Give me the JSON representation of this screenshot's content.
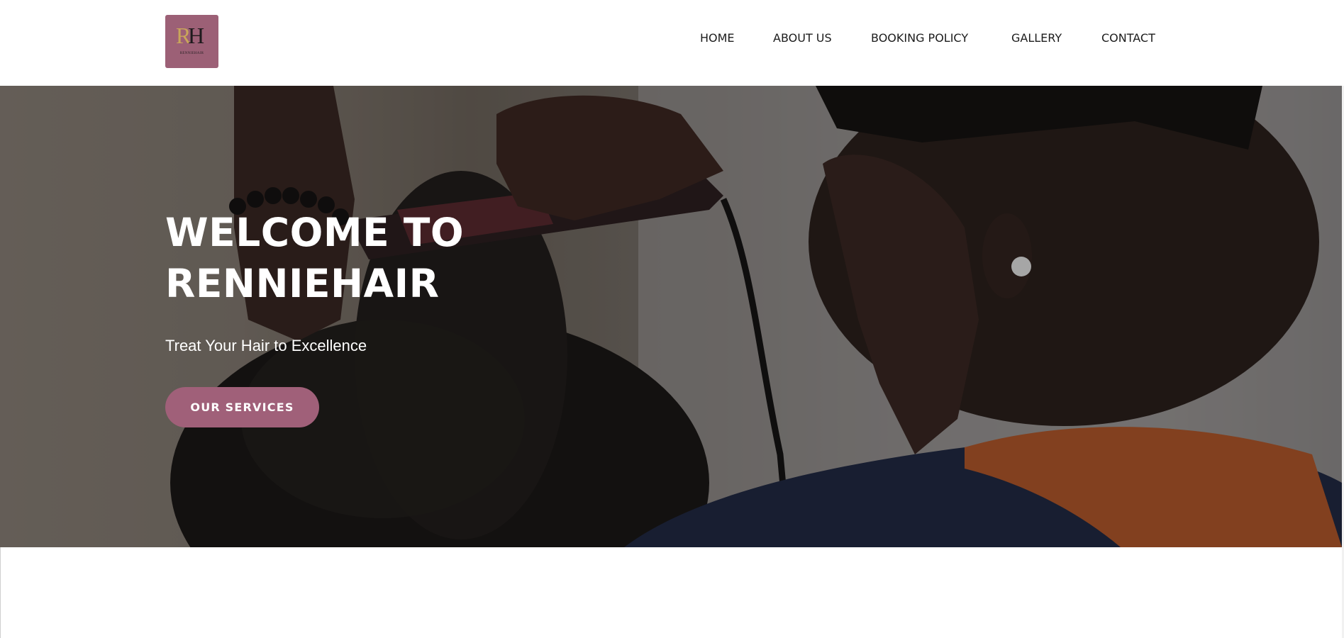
{
  "brand": {
    "logo_letter_r": "R",
    "logo_letter_h": "H",
    "logo_text": "RENNIEHAIR",
    "logo_bg": "#9c6076"
  },
  "nav": {
    "items": [
      {
        "label": "HOME"
      },
      {
        "label": "ABOUT US"
      },
      {
        "label": "BOOKING POLICY"
      },
      {
        "label": "GALLERY"
      },
      {
        "label": "CONTACT"
      }
    ]
  },
  "hero": {
    "title_line1": "WELCOME TO",
    "title_line2": "RENNIEHAIR",
    "subtitle": "Treat Your Hair to Excellence",
    "cta_label": "OUR SERVICES",
    "cta_color": "#a06079",
    "image_description_icon": "hair-straightening-photo"
  }
}
